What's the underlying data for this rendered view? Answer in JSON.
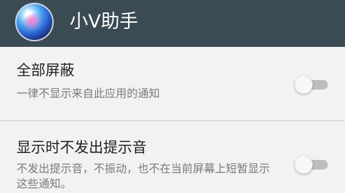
{
  "app_bar": {
    "title": "小V助手",
    "icon": "app-orb-icon",
    "background": "#3a4b53"
  },
  "settings": [
    {
      "title": "全部屏蔽",
      "summary": "一律不显示来自此应用的通知",
      "toggle_on": false
    },
    {
      "title": "显示时不发出提示音",
      "summary": "不发出提示音，不振动，也不在当前屏幕上短暂显示这些通知。",
      "toggle_on": false
    }
  ]
}
